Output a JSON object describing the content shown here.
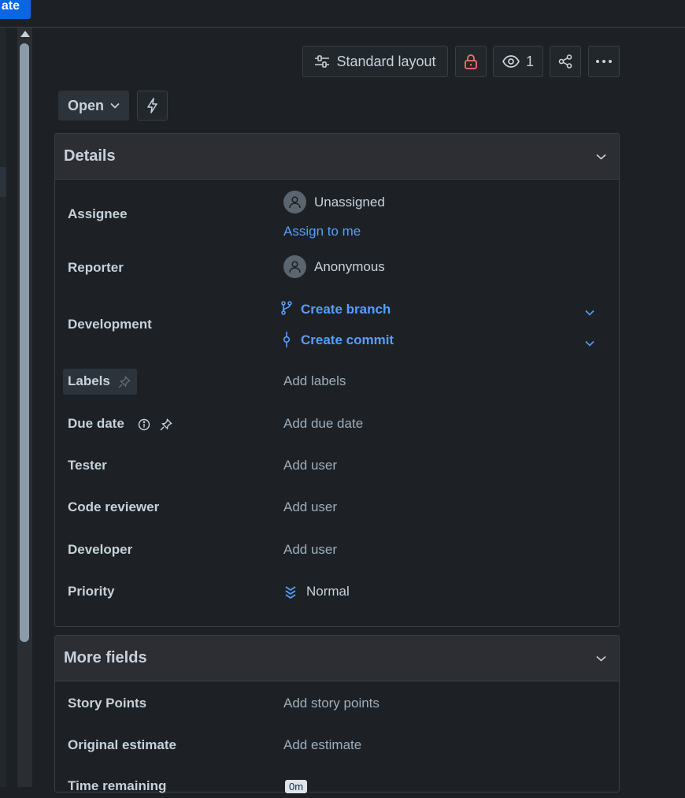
{
  "topbar": {
    "create_label": "ate"
  },
  "toolbar": {
    "layout_label": "Standard layout",
    "watch_count": "1"
  },
  "status": {
    "label": "Open"
  },
  "details": {
    "title": "Details",
    "assignee": {
      "label": "Assignee",
      "value": "Unassigned",
      "assign_link": "Assign to me"
    },
    "reporter": {
      "label": "Reporter",
      "value": "Anonymous"
    },
    "development": {
      "label": "Development",
      "branch": "Create branch",
      "commit": "Create commit"
    },
    "labels": {
      "label": "Labels",
      "value": "Add labels"
    },
    "due_date": {
      "label": "Due date",
      "value": "Add due date"
    },
    "tester": {
      "label": "Tester",
      "value": "Add user"
    },
    "code_reviewer": {
      "label": "Code reviewer",
      "value": "Add user"
    },
    "developer": {
      "label": "Developer",
      "value": "Add user"
    },
    "priority": {
      "label": "Priority",
      "value": "Normal"
    }
  },
  "more_fields": {
    "title": "More fields",
    "story_points": {
      "label": "Story Points",
      "value": "Add story points"
    },
    "original_estimate": {
      "label": "Original estimate",
      "value": "Add estimate"
    },
    "time_remaining": {
      "label": "Time remaining",
      "value": "0m"
    }
  },
  "colors": {
    "accent": "#579dff",
    "brand": "#0c66e4",
    "lock": "#f87168"
  },
  "icons": [
    "layout-icon",
    "lock-icon",
    "eye-icon",
    "share-icon",
    "more-icon",
    "chevron-down-icon",
    "lightning-icon",
    "avatar-icon",
    "branch-icon",
    "commit-icon",
    "info-icon",
    "pin-icon",
    "priority-icon"
  ]
}
